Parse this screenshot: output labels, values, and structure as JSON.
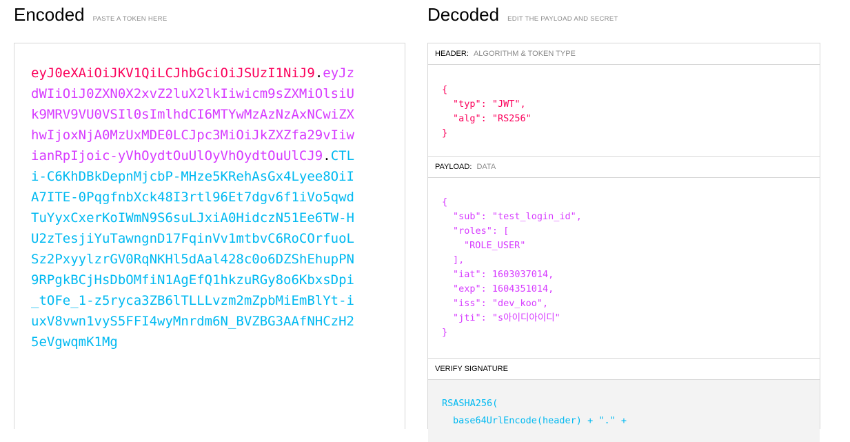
{
  "encoded": {
    "title": "Encoded",
    "subtitle": "PASTE A TOKEN HERE",
    "token_header": "eyJ0eXAiOiJKV1QiLCJhbGciOiJSUzI1NiJ9",
    "token_payload": "eyJzdWIiOiJ0ZXN0X2xvZ2luX2lkIiwicm9sZXMiOlsiUk9MRV9VU0VSIl0sImlhdCI6MTYwMzAzNzAxNCwiZXhwIjoxNjA0MzUxMDE0LCJpc3MiOiJkZXZfa29vIiwianRpIjoic-yVhOydtOuUlOyVhOydtOuUlCJ9",
    "token_signature": "CTLi-C6KhDBkDepnMjcbP-MHze5KRehAsGx4Lyee8OiIA7ITE-0PqgfnbXck48I3rtl96Et7dgv6f1iVo5qwdTuYyxCxerKoIWmN9S6suLJxiA0HidczN51Ee6TW-HU2zTesjiYuTawngnD17FqinVv1mtbvC6RoCOrfuoLSz2PxyylzrGV0RqNKHl5dAal428c0o6DZShEhupPN9RPgkBCjHsDbOMfiN1AgEfQ1hkzuRGy8o6KbxsDpi_tOFe_1-z5ryca3ZB6lTLLLvzm2mZpbMiEmBlYt-iuxV8vwn1vyS5FFI4wyMnrdm6N_BVZBG3AAfNHCzH25eVgwqmK1Mg",
    "dot": "."
  },
  "decoded": {
    "title": "Decoded",
    "subtitle": "EDIT THE PAYLOAD AND SECRET",
    "header_section": {
      "label": "HEADER:",
      "sublabel": "ALGORITHM & TOKEN TYPE",
      "lines": [
        "{",
        "\"typ\": \"JWT\",",
        "\"alg\": \"RS256\"",
        "}"
      ]
    },
    "payload_section": {
      "label": "PAYLOAD:",
      "sublabel": "DATA",
      "lines": [
        "{",
        "\"sub\": \"test_login_id\",",
        "\"roles\": [",
        "\"ROLE_USER\"",
        "],",
        "\"iat\": 1603037014,",
        "\"exp\": 1604351014,",
        "\"iss\": \"dev_koo\",",
        "\"jti\": \"s아이디아이디\"",
        "}"
      ]
    },
    "verify_section": {
      "label": "VERIFY SIGNATURE",
      "lines": [
        "RSASHA256(",
        "base64UrlEncode(header) + \".\" +"
      ]
    }
  },
  "colors": {
    "header": "#fb015b",
    "payload": "#d63aff",
    "signature": "#00b9f1"
  }
}
